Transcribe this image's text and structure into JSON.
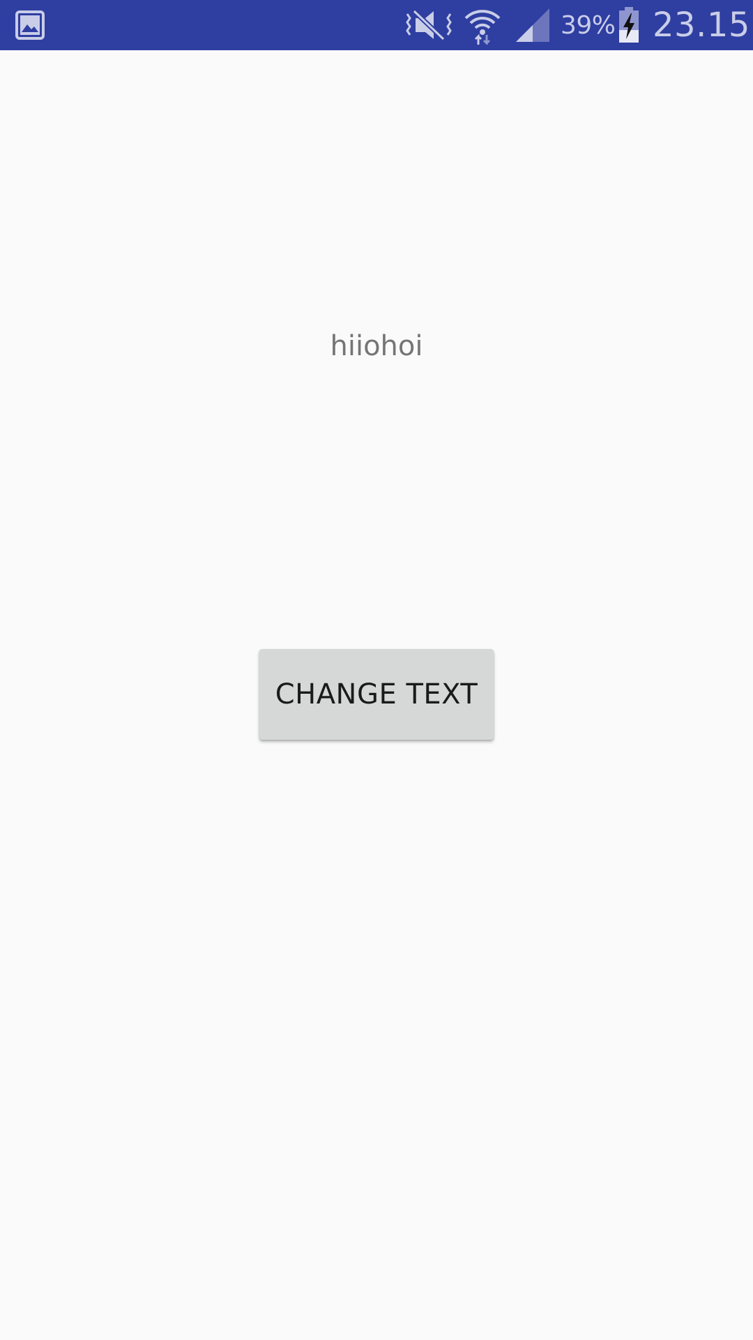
{
  "status_bar": {
    "background": "#2e3ea1",
    "icons": {
      "notification": "gallery-icon",
      "sound": "vibrate-off-icon",
      "wifi": "wifi-icon",
      "signal": "cell-signal-icon",
      "battery": "battery-charging-icon"
    },
    "battery_percent": "39%",
    "battery_level": 0.39,
    "time": "23.15"
  },
  "main": {
    "message": "hiiohoi",
    "button_label": "CHANGE TEXT"
  }
}
